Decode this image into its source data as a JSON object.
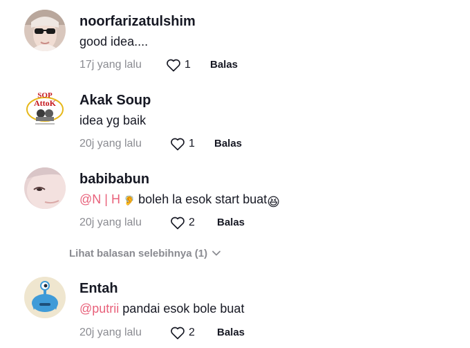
{
  "comments": [
    {
      "username": "noorfarizatulshim",
      "text": "good idea....",
      "time": "17j yang lalu",
      "likes": "1",
      "reply_label": "Balas",
      "avatar": "profile-photo-woman-sunglasses"
    },
    {
      "username": "Akak Soup",
      "text": "idea yg baik",
      "time": "20j yang lalu",
      "likes": "1",
      "reply_label": "Balas",
      "avatar": "sop-attok-logo",
      "avatar_logo_text_top": "SOP",
      "avatar_logo_text_main": "AttoK"
    },
    {
      "username": "babibabun",
      "mention": "@N | H",
      "mention_emoji": "🦻",
      "text": " boleh la esok start buat",
      "emoji": "😆",
      "time": "20j yang lalu",
      "likes": "2",
      "reply_label": "Balas",
      "avatar": "profile-photo-closeup"
    },
    {
      "username": "Entah",
      "mention": "@putrii",
      "text": " pandai esok bole buat",
      "time": "20j yang lalu",
      "likes": "2",
      "reply_label": "Balas",
      "avatar": "cartoon-creature-avatar"
    }
  ],
  "view_more": {
    "label": "Lihat balasan selebihnya (1)"
  },
  "colors": {
    "mention": "#e8607a",
    "muted": "#8a8b91",
    "text": "#161823"
  }
}
